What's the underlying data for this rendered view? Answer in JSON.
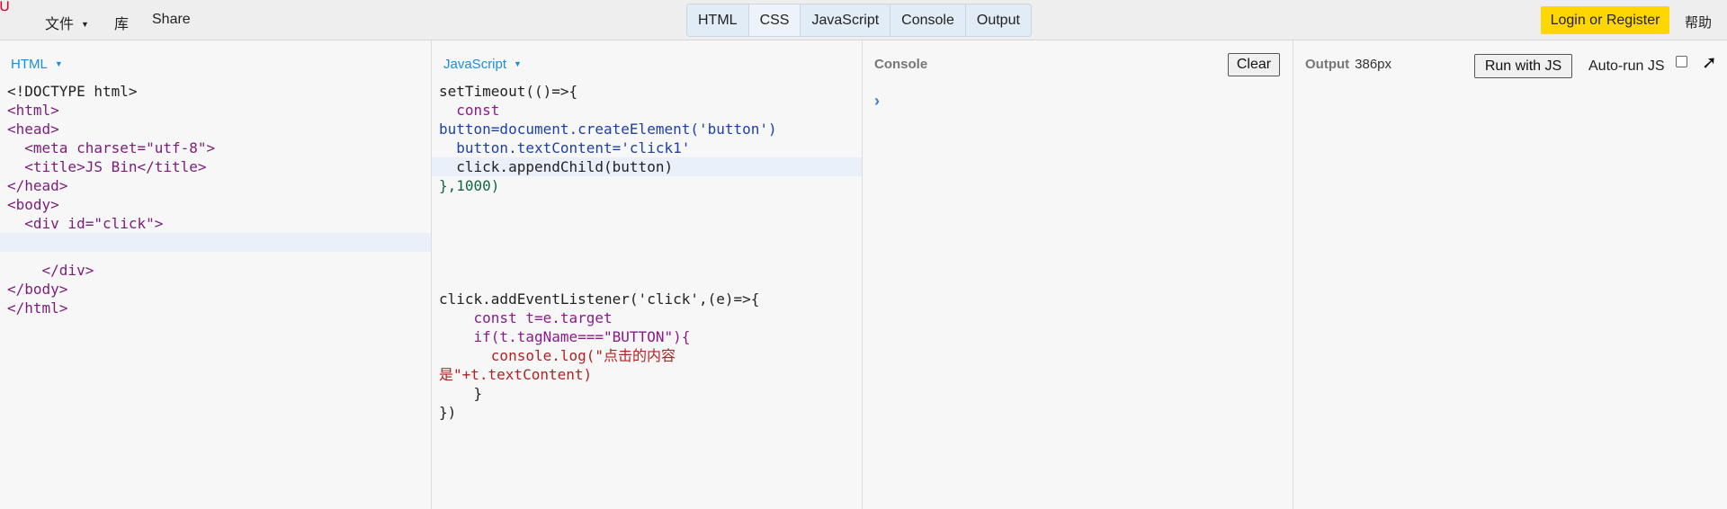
{
  "topbar": {
    "logo_icon": "jsbin-logo-icon",
    "menu": {
      "file_label": "文件",
      "library_label": "库",
      "share_label": "Share"
    },
    "tabs": [
      {
        "label": "HTML",
        "active": true
      },
      {
        "label": "CSS",
        "active": false
      },
      {
        "label": "JavaScript",
        "active": true
      },
      {
        "label": "Console",
        "active": true
      },
      {
        "label": "Output",
        "active": true
      }
    ],
    "login_label": "Login or Register",
    "help_label": "帮助",
    "accent_color": "#ffd700"
  },
  "html_panel": {
    "label": "HTML",
    "code_lines": [
      "<!DOCTYPE html>",
      "<html>",
      "<head>",
      "  <meta charset=\"utf-8\">",
      "  <title>JS Bin</title>",
      "</head>",
      "<body>",
      "  <div id=\"click\">",
      "",
      "",
      "    </div>",
      "</body>",
      "</html>"
    ]
  },
  "js_panel": {
    "label": "JavaScript",
    "code_lines": [
      "setTimeout(()=>{",
      "  const",
      "button=document.createElement('button')",
      "  button.textContent='click1'",
      "  click.appendChild(button)",
      "},1000)",
      "",
      "",
      "",
      "",
      "",
      "click.addEventListener('click',(e)=>{",
      "    const t=e.target",
      "    if(t.tagName===\"BUTTON\"){",
      "      console.log(\"点击的内容",
      "是\"+t.textContent)",
      "    }",
      "})"
    ]
  },
  "console_panel": {
    "label": "Console",
    "clear_label": "Clear",
    "prompt_icon": "chevron-right-icon"
  },
  "output_panel": {
    "label": "Output",
    "size_label": "386px",
    "run_label": "Run with JS",
    "autorun_label": "Auto-run JS",
    "autorun_checked": false,
    "expand_icon": "external-arrow-icon"
  }
}
